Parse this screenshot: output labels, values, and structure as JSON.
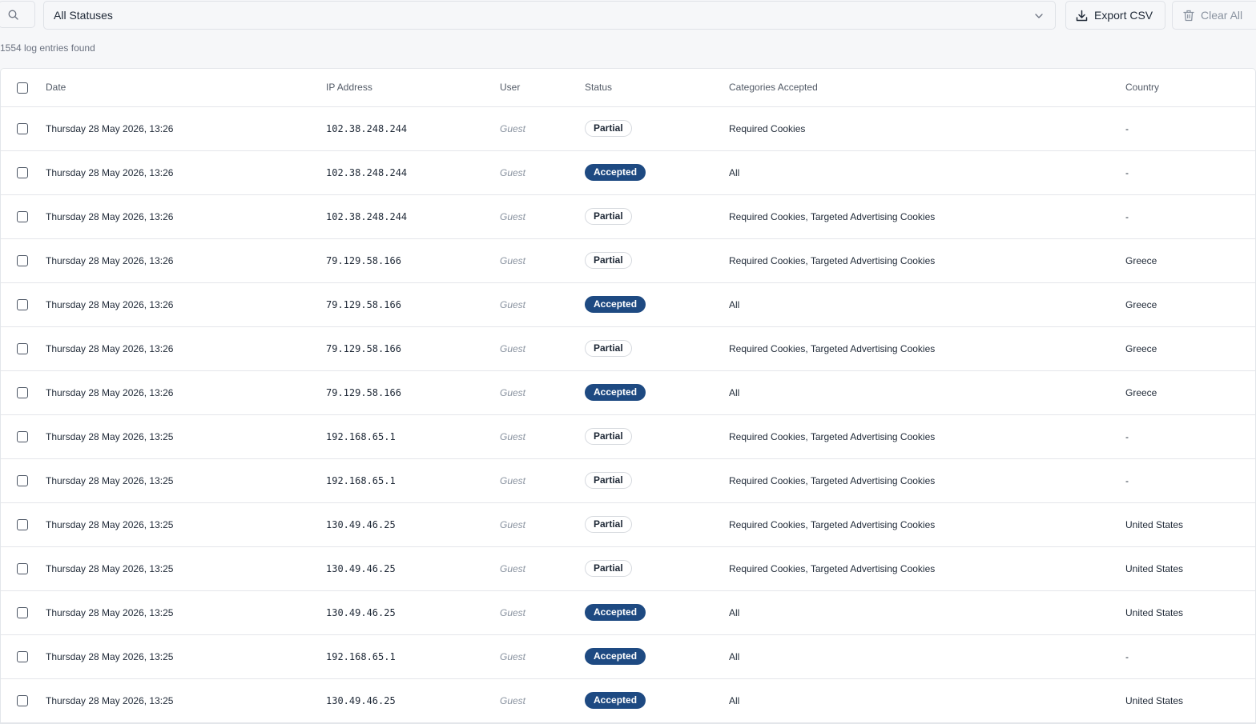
{
  "toolbar": {
    "search_icon": "search-icon",
    "status_filter_value": "All Statuses",
    "status_filter_icon": "chevron-down-icon",
    "export_label": "Export CSV",
    "export_icon": "download-icon",
    "clear_label": "Clear All",
    "clear_icon": "trash-icon"
  },
  "summary": {
    "count_text": "1554 log entries found"
  },
  "table": {
    "columns": {
      "date": "Date",
      "ip": "IP Address",
      "user": "User",
      "status": "Status",
      "categories": "Categories Accepted",
      "country": "Country"
    },
    "rows": [
      {
        "date": "Thursday 28 May 2026, 13:26",
        "ip": "102.38.248.244",
        "user": "Guest",
        "status": "Partial",
        "categories": "Required Cookies",
        "country": "-"
      },
      {
        "date": "Thursday 28 May 2026, 13:26",
        "ip": "102.38.248.244",
        "user": "Guest",
        "status": "Accepted",
        "categories": "All",
        "country": "-"
      },
      {
        "date": "Thursday 28 May 2026, 13:26",
        "ip": "102.38.248.244",
        "user": "Guest",
        "status": "Partial",
        "categories": "Required Cookies, Targeted Advertising Cookies",
        "country": "-"
      },
      {
        "date": "Thursday 28 May 2026, 13:26",
        "ip": "79.129.58.166",
        "user": "Guest",
        "status": "Partial",
        "categories": "Required Cookies, Targeted Advertising Cookies",
        "country": "Greece"
      },
      {
        "date": "Thursday 28 May 2026, 13:26",
        "ip": "79.129.58.166",
        "user": "Guest",
        "status": "Accepted",
        "categories": "All",
        "country": "Greece"
      },
      {
        "date": "Thursday 28 May 2026, 13:26",
        "ip": "79.129.58.166",
        "user": "Guest",
        "status": "Partial",
        "categories": "Required Cookies, Targeted Advertising Cookies",
        "country": "Greece"
      },
      {
        "date": "Thursday 28 May 2026, 13:26",
        "ip": "79.129.58.166",
        "user": "Guest",
        "status": "Accepted",
        "categories": "All",
        "country": "Greece"
      },
      {
        "date": "Thursday 28 May 2026, 13:25",
        "ip": "192.168.65.1",
        "user": "Guest",
        "status": "Partial",
        "categories": "Required Cookies, Targeted Advertising Cookies",
        "country": "-"
      },
      {
        "date": "Thursday 28 May 2026, 13:25",
        "ip": "192.168.65.1",
        "user": "Guest",
        "status": "Partial",
        "categories": "Required Cookies, Targeted Advertising Cookies",
        "country": "-"
      },
      {
        "date": "Thursday 28 May 2026, 13:25",
        "ip": "130.49.46.25",
        "user": "Guest",
        "status": "Partial",
        "categories": "Required Cookies, Targeted Advertising Cookies",
        "country": "United States"
      },
      {
        "date": "Thursday 28 May 2026, 13:25",
        "ip": "130.49.46.25",
        "user": "Guest",
        "status": "Partial",
        "categories": "Required Cookies, Targeted Advertising Cookies",
        "country": "United States"
      },
      {
        "date": "Thursday 28 May 2026, 13:25",
        "ip": "130.49.46.25",
        "user": "Guest",
        "status": "Accepted",
        "categories": "All",
        "country": "United States"
      },
      {
        "date": "Thursday 28 May 2026, 13:25",
        "ip": "192.168.65.1",
        "user": "Guest",
        "status": "Accepted",
        "categories": "All",
        "country": "-"
      },
      {
        "date": "Thursday 28 May 2026, 13:25",
        "ip": "130.49.46.25",
        "user": "Guest",
        "status": "Accepted",
        "categories": "All",
        "country": "United States"
      }
    ]
  },
  "colors": {
    "accepted_badge": "#1e4a82",
    "page_background": "#f6f7f9",
    "table_background": "#ffffff"
  }
}
